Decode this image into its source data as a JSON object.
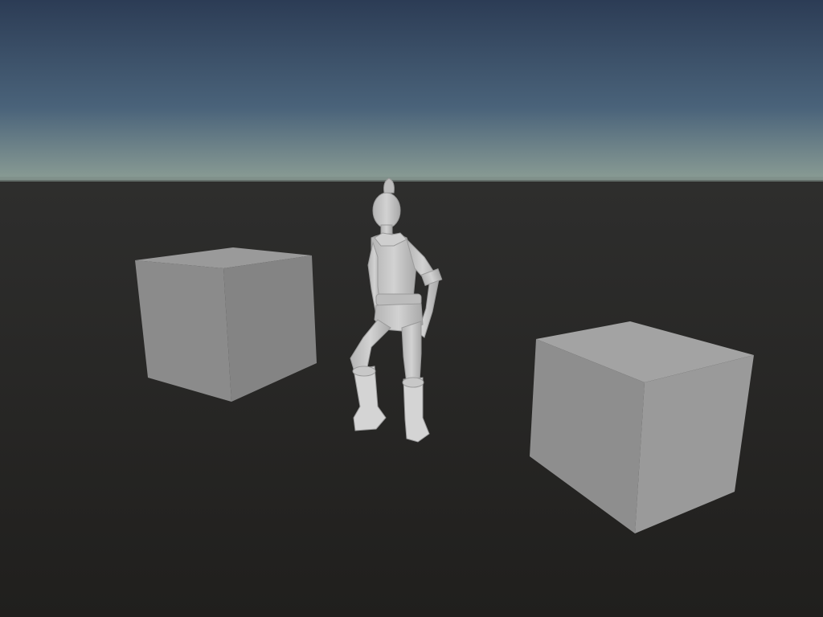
{
  "scene": {
    "sky_top_color": "#2c3c55",
    "sky_mid_color": "#4a637a",
    "horizon_color": "#8a9c94",
    "ground_far_color": "#2e2e2d",
    "ground_near_color": "#201f1d",
    "cube_top_color": "#9c9c9c",
    "cube_left_color": "#8a8a8a",
    "cube_right_color": "#848484",
    "character_color": "#c6c6c6"
  }
}
